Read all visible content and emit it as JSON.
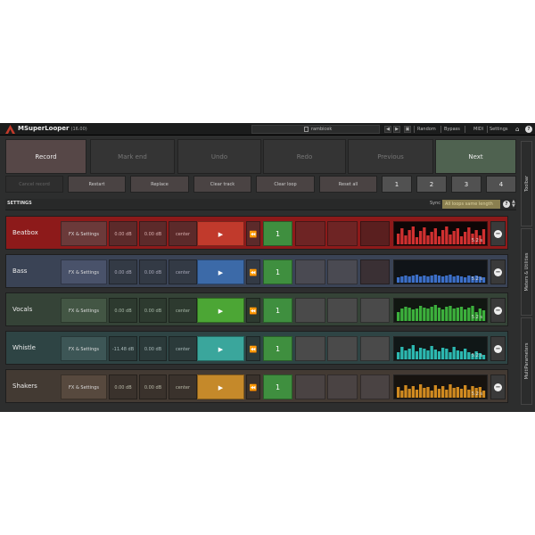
{
  "app": {
    "title": "MSuperLooper",
    "version": "(16.00)",
    "preset": "rambicek",
    "toolbar": [
      "Random",
      "Bypass",
      "MIDI",
      "Settings"
    ]
  },
  "actions": {
    "record": "Record",
    "mark_end": "Mark end",
    "undo": "Undo",
    "redo": "Redo",
    "previous": "Previous",
    "next": "Next"
  },
  "row2": {
    "cancel_record": "Cancel record",
    "restart": "Restart",
    "replace": "Replace",
    "clear_track": "Clear track",
    "clear_loop": "Clear loop",
    "reset_all": "Reset all",
    "loops": [
      "1",
      "2",
      "3",
      "4"
    ]
  },
  "settings": {
    "label": "SETTINGS",
    "sync_label": "Sync",
    "sync_value": "All loops same length",
    "help": "?"
  },
  "tracks": [
    {
      "name": "Beatbox",
      "fx": "FX & Settings",
      "db1": "0.00 dB",
      "db2": "0.00 dB",
      "pan": "center",
      "play": "▶",
      "rew": "⏪",
      "slot": "1",
      "length": "5.2 s",
      "color": "#8d1a1a"
    },
    {
      "name": "Bass",
      "fx": "FX & Settings",
      "db1": "0.00 dB",
      "db2": "0.00 dB",
      "pan": "center",
      "play": "▶",
      "rew": "⏪",
      "slot": "1",
      "length": "5.2 s",
      "color": "#3a4355"
    },
    {
      "name": "Vocals",
      "fx": "FX & Settings",
      "db1": "0.00 dB",
      "db2": "0.00 dB",
      "pan": "center",
      "play": "▶",
      "rew": "⏪",
      "slot": "1",
      "length": "5.2 s",
      "color": "#354337"
    },
    {
      "name": "Whistle",
      "fx": "FX & Settings",
      "db1": "-11.48 dB",
      "db2": "0.00 dB",
      "pan": "center",
      "play": "▶",
      "rew": "⏪",
      "slot": "1",
      "length": "5.2 s",
      "color": "#2e4444"
    },
    {
      "name": "Shakers",
      "fx": "FX & Settings",
      "db1": "0.00 dB",
      "db2": "0.00 dB",
      "pan": "center",
      "play": "▶",
      "rew": "⏪",
      "slot": "1",
      "length": "5.2 s",
      "color": "#433a33"
    }
  ],
  "sidetabs": [
    "Toolbar",
    "Meters & Utilities",
    "MultiParameters"
  ],
  "colors": {
    "record": "#564747",
    "next": "#4f6250",
    "slot_active": "#3f8f3f",
    "play_beatbox": "#c13a2c",
    "play_bass": "#3c6aa8",
    "play_vocals": "#4ca635",
    "play_whistle": "#3aa69c",
    "play_shakers": "#c5892a",
    "wave_beatbox": "#d03030",
    "wave_bass": "#3c6fc8",
    "wave_vocals": "#3cb03c",
    "wave_whistle": "#2cb8b0",
    "wave_shakers": "#d08a20"
  }
}
